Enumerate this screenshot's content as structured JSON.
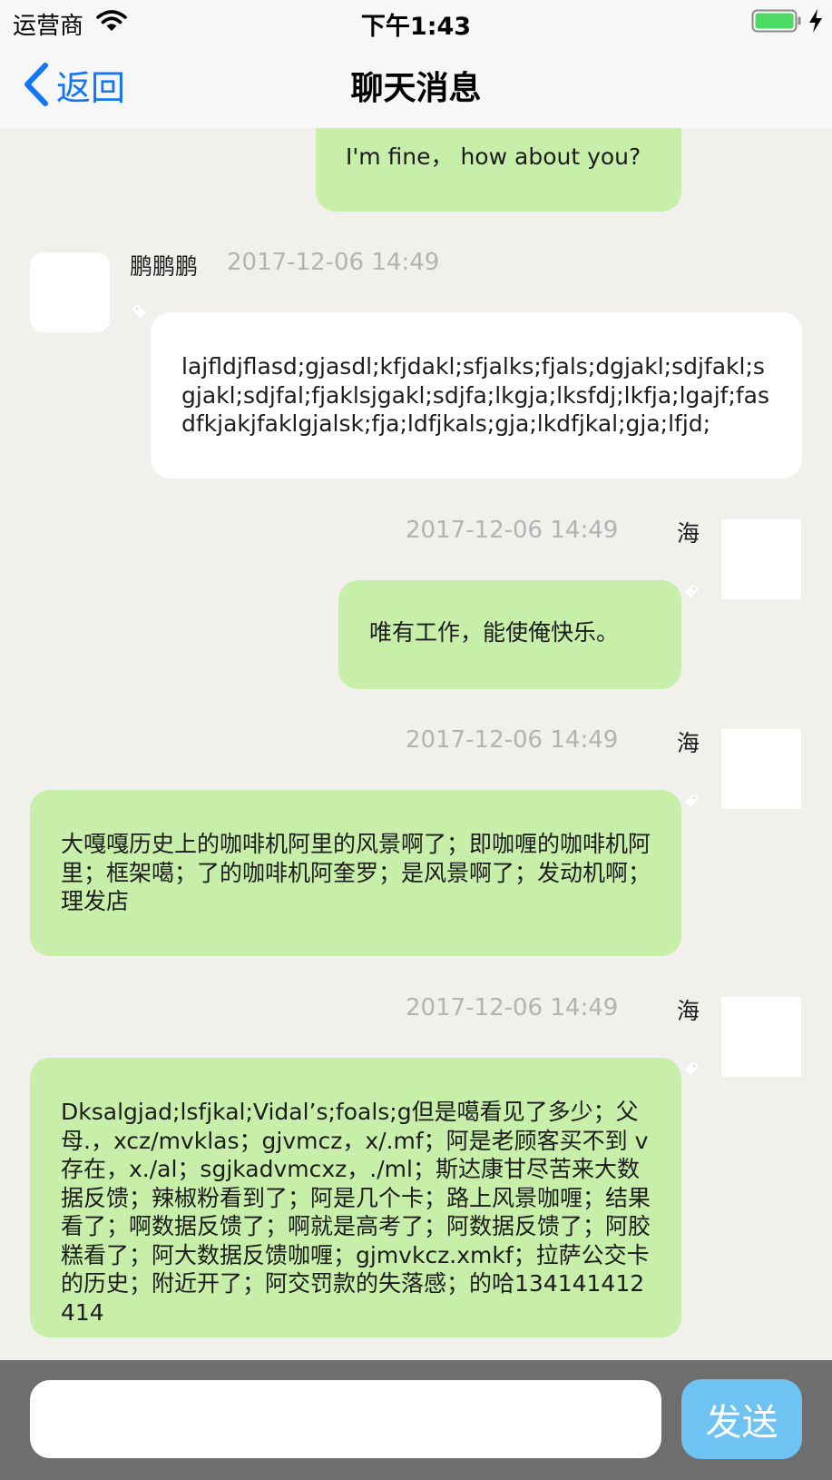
{
  "status_bar": {
    "carrier": "运营商",
    "time": "下午1:43",
    "wifi_icon": "wifi-icon",
    "battery_icon": "battery-full-icon",
    "charging_icon": "charging-bolt-icon",
    "battery_color": "#4cd964"
  },
  "nav": {
    "back_label": "返回",
    "back_icon": "chevron-left-icon",
    "title": "聊天消息",
    "accent_color": "#1377f5"
  },
  "messages": [
    {
      "direction": "outgoing",
      "sender": "",
      "timestamp": "",
      "text": "I'm fine， how about you?"
    },
    {
      "direction": "incoming",
      "sender": "鹏鹏鹏",
      "timestamp": "2017-12-06 14:49",
      "text": "lajfldjflasd;gjasdl;kfjdakl;sfjalks;fjals;dgjakl;sdjfakl;sgjakl;sdjfal;fjaklsjgakl;sdjfa;lkgja;lksfdj;lkfja;lgajf;fasdfkjakjfaklgjalsk;fja;ldfjkals;gja;lkdfjkal;gja;lfjd;"
    },
    {
      "direction": "outgoing",
      "sender": "海",
      "timestamp": "2017-12-06 14:49",
      "text": "唯有工作，能使俺快乐。"
    },
    {
      "direction": "outgoing",
      "sender": "海",
      "timestamp": "2017-12-06 14:49",
      "text": "大嘎嘎历史上的咖啡机阿里的风景啊了；即咖喱的咖啡机阿里；框架噶；了的咖啡机阿奎罗；是风景啊了；发动机啊；理发店"
    },
    {
      "direction": "outgoing",
      "sender": "海",
      "timestamp": "2017-12-06 14:49",
      "text": "Dksalgjad;lsfjkal;Vidal’s;foals;g但是噶看见了多少；父母.，xcz/mvklas；gjvmcz，x/.mf；阿是老顾客买不到 v 存在，x./al；sgjkadvmcxz，./ml；斯达康甘尽苦来大数据反馈；辣椒粉看到了；阿是几个卡；路上风景咖喱；结果看了；啊数据反馈了；啊就是高考了；阿数据反馈了；阿胶糕看了；阿大数据反馈咖喱；gjmvkcz.xmkf；拉萨公交卡的历史；附近开了；阿交罚款的失落感；的哈134141412414"
    }
  ],
  "input_bar": {
    "input_value": "",
    "input_placeholder": "",
    "send_label": "发送",
    "send_color": "#6ec3f3",
    "outgoing_bubble_color": "#c8efaa",
    "incoming_bubble_color": "#ffffff"
  }
}
